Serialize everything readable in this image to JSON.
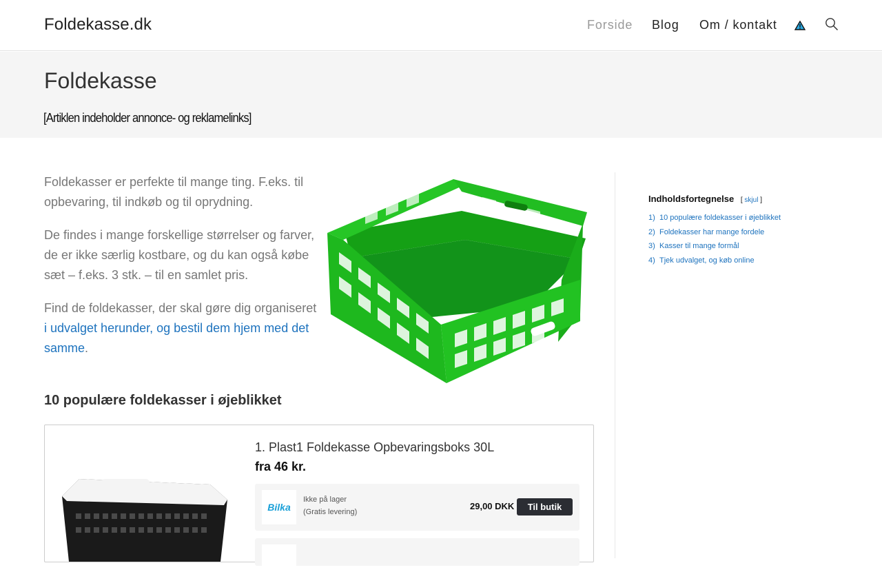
{
  "site": {
    "logo": "Foldekasse.dk",
    "nav": [
      {
        "label": "Forside",
        "active": true
      },
      {
        "label": "Blog",
        "active": false
      },
      {
        "label": "Om / kontakt",
        "active": false
      }
    ],
    "icons": {
      "warning": "warning-triangle-icon",
      "search": "search-icon"
    }
  },
  "page": {
    "title": "Foldekasse",
    "disclaimer": "[Artiklen indeholder annonce- og reklamelinks]"
  },
  "intro": {
    "p1": "Foldekasser er perfekte til mange ting. F.eks. til opbevaring, til indkøb og til oprydning.",
    "p2": "De findes i mange forskellige størrelser og farver, de er ikke særlig kostbare, og du kan også købe sæt – f.eks. 3 stk. – til en samlet pris.",
    "p3_prefix": "Find de foldekasser, der skal gøre dig organiseret ",
    "p3_link": "i udvalget herunder, og bestil dem hjem med det samme",
    "p3_suffix": "."
  },
  "section": {
    "heading": "10 populære foldekasser i øjeblikket"
  },
  "product": {
    "title": "1. Plast1 Foldekasse Opbevaringsboks 30L",
    "price": "fra 46 kr.",
    "offer": {
      "shop": "Bilka",
      "stock": "Ikke på lager",
      "shipping": "(Gratis levering)",
      "amount": "29,00 DKK",
      "button": "Til butik"
    }
  },
  "toc": {
    "title": "Indholdsfortegnelse",
    "toggle_open": "[",
    "toggle_link": "skjul",
    "toggle_close": "]",
    "items": [
      {
        "num": "1)",
        "label": "10 populære foldekasser i øjeblikket"
      },
      {
        "num": "2)",
        "label": "Foldekasser har mange fordele"
      },
      {
        "num": "3)",
        "label": "Kasser til mange formål"
      },
      {
        "num": "4)",
        "label": "Tjek udvalget, og køb online"
      }
    ]
  },
  "colors": {
    "accent_link": "#1e73be",
    "crate_green": "#1fb21f",
    "button_dark": "#2b2d33"
  }
}
